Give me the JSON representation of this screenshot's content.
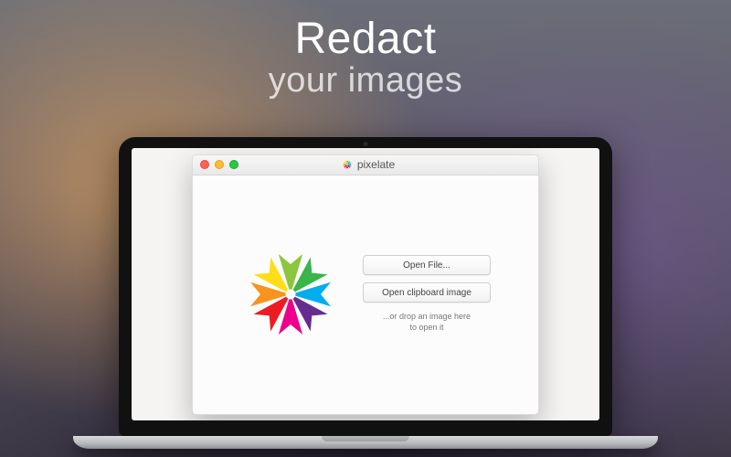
{
  "headline": {
    "line1": "Redact",
    "line2": "your images"
  },
  "app": {
    "title": "pixelate",
    "buttons": {
      "open_file": "Open File...",
      "open_clipboard": "Open clipboard image"
    },
    "drop_hint_line1": "...or drop an image here",
    "drop_hint_line2": "to open it"
  },
  "logo": {
    "blades": [
      "#8CC63F",
      "#39B54A",
      "#00AEEF",
      "#662D91",
      "#EC008C",
      "#ED1C24",
      "#F7941D",
      "#FFDE17"
    ]
  }
}
